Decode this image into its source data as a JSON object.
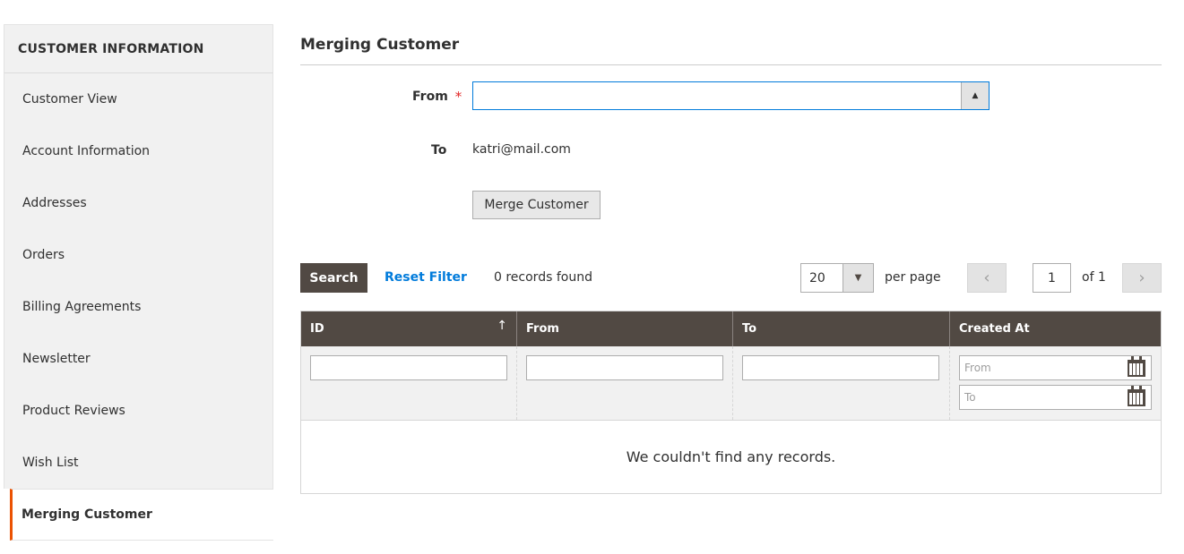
{
  "sidebar": {
    "header": "CUSTOMER INFORMATION",
    "items": [
      {
        "label": "Customer View"
      },
      {
        "label": "Account Information"
      },
      {
        "label": "Addresses"
      },
      {
        "label": "Orders"
      },
      {
        "label": "Billing Agreements"
      },
      {
        "label": "Newsletter"
      },
      {
        "label": "Product Reviews"
      },
      {
        "label": "Wish List"
      },
      {
        "label": "Merging Customer"
      }
    ],
    "active_item": "Merging Customer"
  },
  "main": {
    "title": "Merging Customer",
    "form": {
      "from_label": "From",
      "required_mark": "*",
      "from_value": "",
      "to_label": "To",
      "to_value": "katri@mail.com",
      "merge_button": "Merge Customer"
    },
    "toolbar": {
      "search_button": "Search",
      "reset_filter": "Reset Filter",
      "records_found": "0 records found",
      "per_page_value": "20",
      "per_page_label": "per page",
      "current_page": "1",
      "of_pages": "of 1"
    },
    "grid": {
      "columns": [
        {
          "label": "ID",
          "sort": "ascending"
        },
        {
          "label": "From"
        },
        {
          "label": "To"
        },
        {
          "label": "Created At"
        }
      ],
      "date_filter_from_placeholder": "From",
      "date_filter_to_placeholder": "To",
      "empty_message": "We couldn't find any records."
    }
  },
  "colors": {
    "accent_active": "#eb5202",
    "header_dark": "#514943",
    "link_blue": "#007bdb",
    "required_red": "#e22626"
  }
}
